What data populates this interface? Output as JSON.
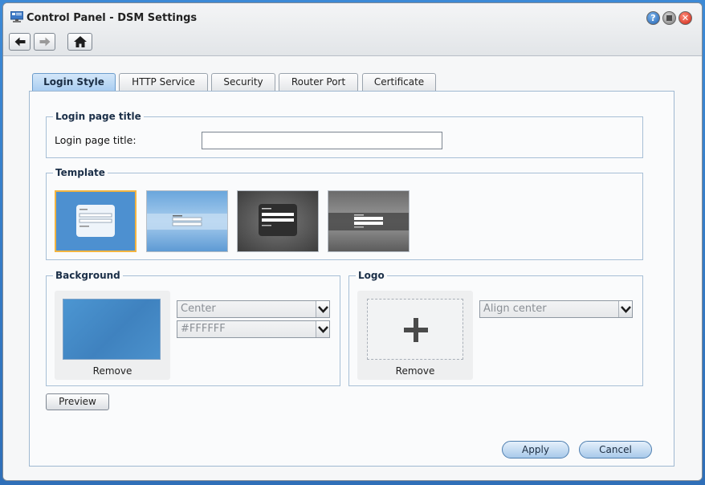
{
  "window": {
    "title": "Control Panel - DSM Settings",
    "help_glyph": "?",
    "close_glyph": "✕"
  },
  "tabs": [
    {
      "label": "Login Style",
      "active": true
    },
    {
      "label": "HTTP Service",
      "active": false
    },
    {
      "label": "Security",
      "active": false
    },
    {
      "label": "Router Port",
      "active": false
    },
    {
      "label": "Certificate",
      "active": false
    }
  ],
  "login_title_section": {
    "legend": "Login page title",
    "field_label": "Login page title:",
    "field_value": ""
  },
  "template_section": {
    "legend": "Template",
    "templates": [
      {
        "selected": true
      },
      {
        "selected": false
      },
      {
        "selected": false
      },
      {
        "selected": false
      }
    ]
  },
  "background_section": {
    "legend": "Background",
    "remove_label": "Remove",
    "position_value": "Center",
    "color_value": "#FFFFFF"
  },
  "logo_section": {
    "legend": "Logo",
    "remove_label": "Remove",
    "align_value": "Align center"
  },
  "buttons": {
    "preview": "Preview",
    "apply": "Apply",
    "cancel": "Cancel"
  },
  "colors": {
    "accent": "#a9cdf1",
    "selected_border": "#f2b441",
    "background_color": "#FFFFFF"
  },
  "icons": {
    "back": "back-arrow-icon",
    "forward": "forward-arrow-icon",
    "home": "home-icon",
    "help": "help-icon",
    "minimize": "minimize-icon",
    "close": "close-icon",
    "add": "plus-icon"
  }
}
